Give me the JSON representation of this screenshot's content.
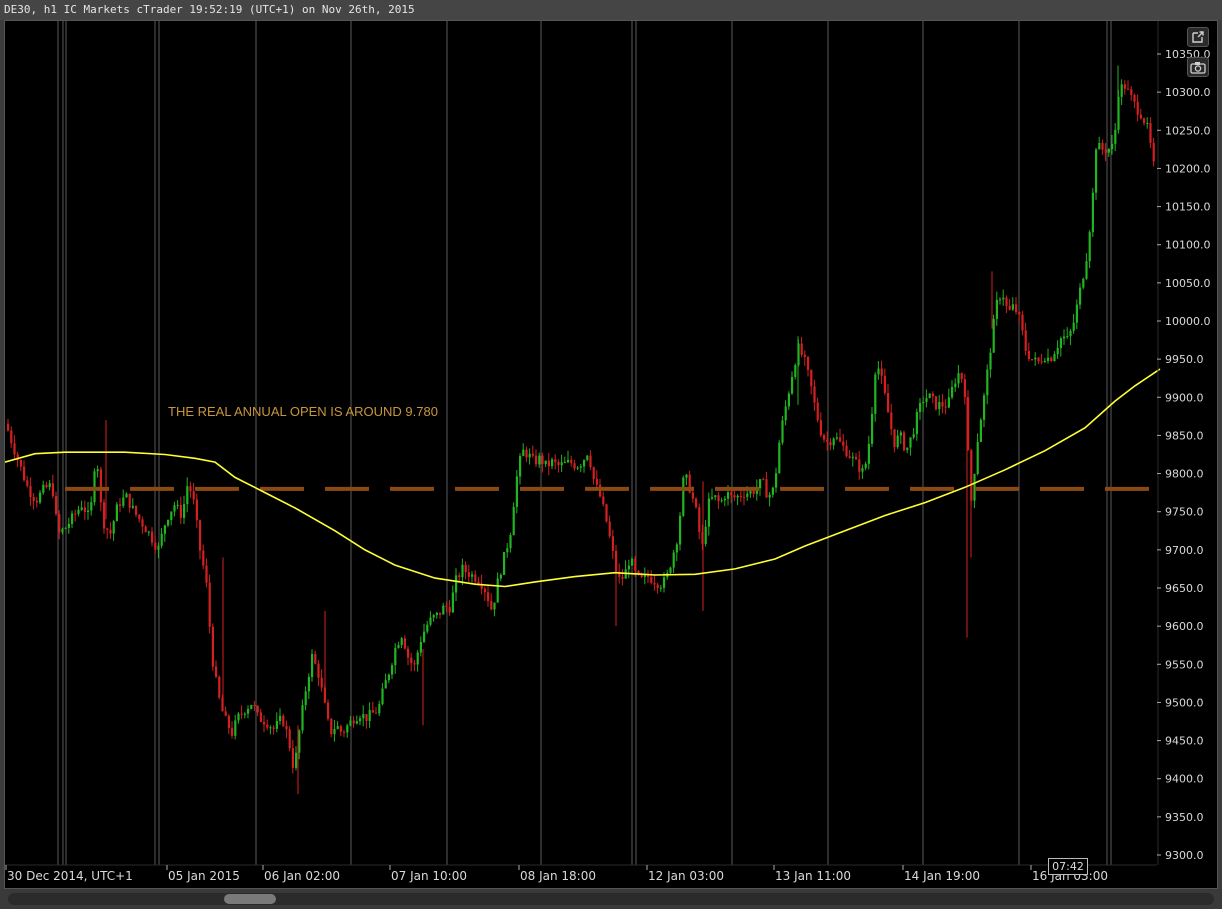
{
  "window": {
    "title": "DE30, h1 IC Markets cTrader 19:52:19 (UTC+1) on Nov 26th, 2015"
  },
  "toolbar": {
    "popout_icon": "external-link-icon",
    "screenshot_icon": "camera-icon"
  },
  "chart": {
    "symbol": "DE30",
    "timeframe": "h1",
    "annotation_text": "THE REAL ANNUAL OPEN IS AROUND 9.780",
    "annual_open_level": 9780,
    "current_time_label": "07:42",
    "colors": {
      "background": "#000000",
      "bull": "#21b521",
      "bear": "#d42020",
      "ma_line": "#ffff33",
      "level_line": "#8b4a14",
      "annotation": "#c8963c",
      "axis_text": "#d9d9d9",
      "separator": "#5a5a5a"
    }
  },
  "chart_data": {
    "type": "candlestick",
    "y_ticks": [
      "10350.0",
      "10300.0",
      "10250.0",
      "10200.0",
      "10150.0",
      "10100.0",
      "10050.0",
      "10000.0",
      "9950.0",
      "9900.0",
      "9850.0",
      "9800.0",
      "9750.0",
      "9700.0",
      "9650.0",
      "9600.0",
      "9550.0",
      "9500.0",
      "9450.0",
      "9400.0",
      "9350.0",
      "9300.0"
    ],
    "y_tick_values": [
      10350,
      10300,
      10250,
      10200,
      10150,
      10100,
      10050,
      10000,
      9950,
      9900,
      9850,
      9800,
      9750,
      9700,
      9650,
      9600,
      9550,
      9500,
      9450,
      9400,
      9350,
      9300
    ],
    "ylim": [
      9290,
      10370
    ],
    "x_labels": [
      "30 Dec 2014, UTC+1",
      "05 Jan 2015",
      "06 Jan 02:00",
      "07 Jan 10:00",
      "08 Jan 18:00",
      "12 Jan 03:00",
      "13 Jan 11:00",
      "14 Jan 19:00",
      "16 Jan 03:00"
    ],
    "price_path": [
      [
        0,
        9865
      ],
      [
        6,
        9840
      ],
      [
        14,
        9810
      ],
      [
        22,
        9780
      ],
      [
        30,
        9765
      ],
      [
        38,
        9780
      ],
      [
        46,
        9785
      ],
      [
        52,
        9720
      ],
      [
        60,
        9730
      ],
      [
        68,
        9745
      ],
      [
        76,
        9760
      ],
      [
        84,
        9740
      ],
      [
        90,
        9835
      ],
      [
        96,
        9740
      ],
      [
        104,
        9720
      ],
      [
        112,
        9760
      ],
      [
        120,
        9770
      ],
      [
        128,
        9750
      ],
      [
        136,
        9735
      ],
      [
        144,
        9720
      ],
      [
        152,
        9700
      ],
      [
        160,
        9740
      ],
      [
        168,
        9760
      ],
      [
        176,
        9745
      ],
      [
        182,
        9790
      ],
      [
        188,
        9760
      ],
      [
        194,
        9700
      ],
      [
        200,
        9660
      ],
      [
        206,
        9560
      ],
      [
        212,
        9510
      ],
      [
        218,
        9480
      ],
      [
        226,
        9460
      ],
      [
        232,
        9480
      ],
      [
        238,
        9490
      ],
      [
        246,
        9500
      ],
      [
        252,
        9480
      ],
      [
        260,
        9475
      ],
      [
        268,
        9465
      ],
      [
        276,
        9480
      ],
      [
        282,
        9455
      ],
      [
        288,
        9410
      ],
      [
        294,
        9470
      ],
      [
        300,
        9520
      ],
      [
        306,
        9560
      ],
      [
        312,
        9540
      ],
      [
        318,
        9500
      ],
      [
        324,
        9460
      ],
      [
        330,
        9470
      ],
      [
        336,
        9460
      ],
      [
        342,
        9470
      ],
      [
        348,
        9480
      ],
      [
        354,
        9485
      ],
      [
        360,
        9480
      ],
      [
        366,
        9485
      ],
      [
        372,
        9490
      ],
      [
        378,
        9520
      ],
      [
        384,
        9545
      ],
      [
        390,
        9575
      ],
      [
        396,
        9590
      ],
      [
        402,
        9560
      ],
      [
        408,
        9545
      ],
      [
        414,
        9580
      ],
      [
        420,
        9600
      ],
      [
        426,
        9610
      ],
      [
        432,
        9615
      ],
      [
        438,
        9625
      ],
      [
        444,
        9625
      ],
      [
        450,
        9660
      ],
      [
        456,
        9675
      ],
      [
        462,
        9670
      ],
      [
        468,
        9665
      ],
      [
        474,
        9660
      ],
      [
        480,
        9645
      ],
      [
        486,
        9620
      ],
      [
        492,
        9660
      ],
      [
        498,
        9690
      ],
      [
        504,
        9720
      ],
      [
        510,
        9790
      ],
      [
        516,
        9830
      ],
      [
        522,
        9825
      ],
      [
        528,
        9815
      ],
      [
        534,
        9820
      ],
      [
        540,
        9810
      ],
      [
        546,
        9815
      ],
      [
        552,
        9810
      ],
      [
        558,
        9812
      ],
      [
        564,
        9815
      ],
      [
        570,
        9810
      ],
      [
        576,
        9815
      ],
      [
        582,
        9830
      ],
      [
        588,
        9790
      ],
      [
        594,
        9770
      ],
      [
        600,
        9740
      ],
      [
        606,
        9700
      ],
      [
        612,
        9660
      ],
      [
        618,
        9665
      ],
      [
        624,
        9690
      ],
      [
        630,
        9665
      ],
      [
        636,
        9660
      ],
      [
        642,
        9665
      ],
      [
        648,
        9660
      ],
      [
        654,
        9655
      ],
      [
        660,
        9660
      ],
      [
        666,
        9690
      ],
      [
        672,
        9720
      ],
      [
        678,
        9800
      ],
      [
        684,
        9780
      ],
      [
        690,
        9750
      ],
      [
        696,
        9700
      ],
      [
        702,
        9760
      ],
      [
        708,
        9770
      ],
      [
        714,
        9760
      ],
      [
        720,
        9775
      ],
      [
        726,
        9768
      ],
      [
        732,
        9770
      ],
      [
        738,
        9775
      ],
      [
        744,
        9775
      ],
      [
        750,
        9780
      ],
      [
        756,
        9790
      ],
      [
        762,
        9770
      ],
      [
        768,
        9780
      ],
      [
        774,
        9850
      ],
      [
        780,
        9890
      ],
      [
        786,
        9930
      ],
      [
        792,
        9965
      ],
      [
        798,
        9950
      ],
      [
        804,
        9920
      ],
      [
        810,
        9880
      ],
      [
        816,
        9850
      ],
      [
        822,
        9840
      ],
      [
        828,
        9850
      ],
      [
        834,
        9840
      ],
      [
        840,
        9830
      ],
      [
        846,
        9820
      ],
      [
        852,
        9810
      ],
      [
        858,
        9800
      ],
      [
        864,
        9850
      ],
      [
        870,
        9950
      ],
      [
        876,
        9920
      ],
      [
        882,
        9880
      ],
      [
        888,
        9840
      ],
      [
        894,
        9850
      ],
      [
        900,
        9830
      ],
      [
        906,
        9850
      ],
      [
        912,
        9880
      ],
      [
        918,
        9900
      ],
      [
        924,
        9900
      ],
      [
        930,
        9890
      ],
      [
        936,
        9890
      ],
      [
        942,
        9890
      ],
      [
        948,
        9920
      ],
      [
        954,
        9935
      ],
      [
        960,
        9900
      ],
      [
        964,
        9750
      ],
      [
        968,
        9800
      ],
      [
        972,
        9850
      ],
      [
        978,
        9900
      ],
      [
        984,
        9960
      ],
      [
        990,
        10020
      ],
      [
        996,
        10040
      ],
      [
        1002,
        10010
      ],
      [
        1008,
        10020
      ],
      [
        1014,
        10000
      ],
      [
        1020,
        9960
      ],
      [
        1026,
        9950
      ],
      [
        1032,
        9945
      ],
      [
        1038,
        9955
      ],
      [
        1044,
        9950
      ],
      [
        1050,
        9965
      ],
      [
        1056,
        9980
      ],
      [
        1062,
        9975
      ],
      [
        1068,
        10000
      ],
      [
        1074,
        10040
      ],
      [
        1080,
        10080
      ],
      [
        1086,
        10150
      ],
      [
        1090,
        10230
      ],
      [
        1096,
        10225
      ],
      [
        1102,
        10225
      ],
      [
        1108,
        10230
      ],
      [
        1112,
        10300
      ],
      [
        1118,
        10310
      ],
      [
        1124,
        10295
      ],
      [
        1130,
        10280
      ],
      [
        1136,
        10270
      ],
      [
        1142,
        10250
      ],
      [
        1148,
        10200
      ],
      [
        1152,
        10200
      ]
    ],
    "ma_series": [
      [
        0,
        9815
      ],
      [
        30,
        9826
      ],
      [
        60,
        9828
      ],
      [
        120,
        9828
      ],
      [
        160,
        9825
      ],
      [
        190,
        9820
      ],
      [
        210,
        9815
      ],
      [
        230,
        9795
      ],
      [
        260,
        9775
      ],
      [
        290,
        9755
      ],
      [
        330,
        9725
      ],
      [
        360,
        9700
      ],
      [
        390,
        9680
      ],
      [
        430,
        9663
      ],
      [
        470,
        9655
      ],
      [
        500,
        9652
      ],
      [
        530,
        9658
      ],
      [
        570,
        9665
      ],
      [
        610,
        9670
      ],
      [
        650,
        9667
      ],
      [
        690,
        9668
      ],
      [
        730,
        9675
      ],
      [
        770,
        9688
      ],
      [
        800,
        9705
      ],
      [
        840,
        9725
      ],
      [
        880,
        9745
      ],
      [
        920,
        9762
      ],
      [
        960,
        9782
      ],
      [
        1000,
        9805
      ],
      [
        1040,
        9830
      ],
      [
        1080,
        9860
      ],
      [
        1110,
        9895
      ],
      [
        1130,
        9915
      ],
      [
        1155,
        9937
      ]
    ],
    "session_separators": [
      53,
      58,
      61,
      150,
      154,
      251,
      346,
      442,
      536,
      627,
      631,
      727,
      823,
      918,
      1014,
      1102,
      1106
    ]
  }
}
